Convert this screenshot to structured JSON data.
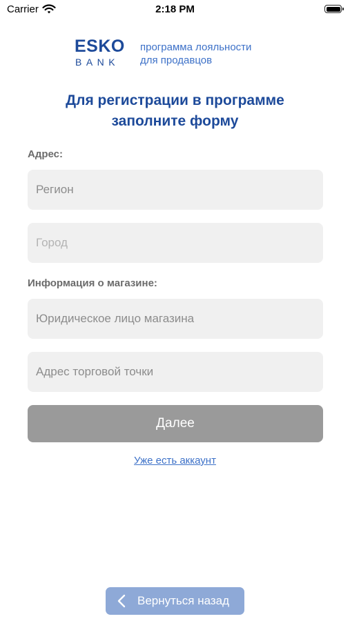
{
  "status_bar": {
    "carrier": "Carrier",
    "time": "2:18 PM"
  },
  "logo": {
    "brand_top": "ESKO",
    "brand_bottom": "BANK",
    "tagline_line1": "программа лояльности",
    "tagline_line2": "для продавцов"
  },
  "title": {
    "line1": "Для регистрации в программе",
    "line2": "заполните форму"
  },
  "address_section": {
    "label": "Адрес:",
    "region_placeholder": "Регион",
    "city_placeholder": "Город"
  },
  "store_section": {
    "label": "Информация о магазине:",
    "legal_entity_placeholder": "Юридическое лицо магазина",
    "store_address_placeholder": "Адрес торговой точки"
  },
  "actions": {
    "next_label": "Далее",
    "have_account_label": "Уже есть аккаунт",
    "back_label": "Вернуться назад"
  },
  "colors": {
    "brand_blue": "#1d4a9a",
    "accent_blue": "#3d71c8",
    "back_button": "#8ea9d7",
    "next_button_disabled": "#9a9a9a",
    "field_background": "#f0f0f0"
  }
}
